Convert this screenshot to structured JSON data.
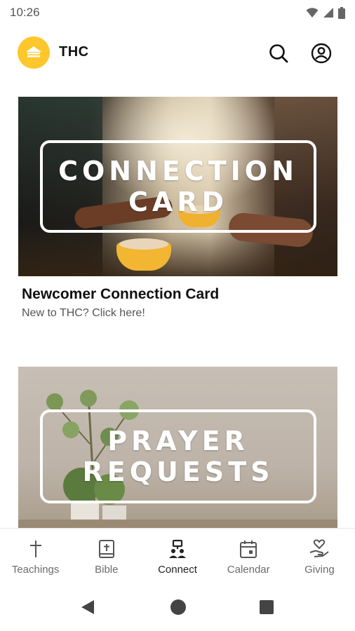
{
  "status_bar": {
    "time": "10:26",
    "icons": [
      "wifi-icon",
      "signal-icon",
      "battery-icon"
    ]
  },
  "header": {
    "title": "THC",
    "logo_color": "#FFC72C",
    "actions": [
      "search-icon",
      "account-icon"
    ]
  },
  "cards": [
    {
      "overlay_line1": "CONNECTION",
      "overlay_line2": "CARD",
      "title": "Newcomer Connection Card",
      "subtitle": "New to THC? Click here!"
    },
    {
      "overlay_line1": "PRAYER",
      "overlay_line2": "REQUESTS"
    }
  ],
  "bottom_nav": {
    "items": [
      {
        "label": "Teachings",
        "icon": "cross-icon"
      },
      {
        "label": "Bible",
        "icon": "bible-icon"
      },
      {
        "label": "Connect",
        "icon": "connect-icon",
        "active": true
      },
      {
        "label": "Calendar",
        "icon": "calendar-icon"
      },
      {
        "label": "Giving",
        "icon": "giving-icon"
      }
    ]
  },
  "system_nav": [
    "back-icon",
    "home-icon",
    "recents-icon"
  ]
}
